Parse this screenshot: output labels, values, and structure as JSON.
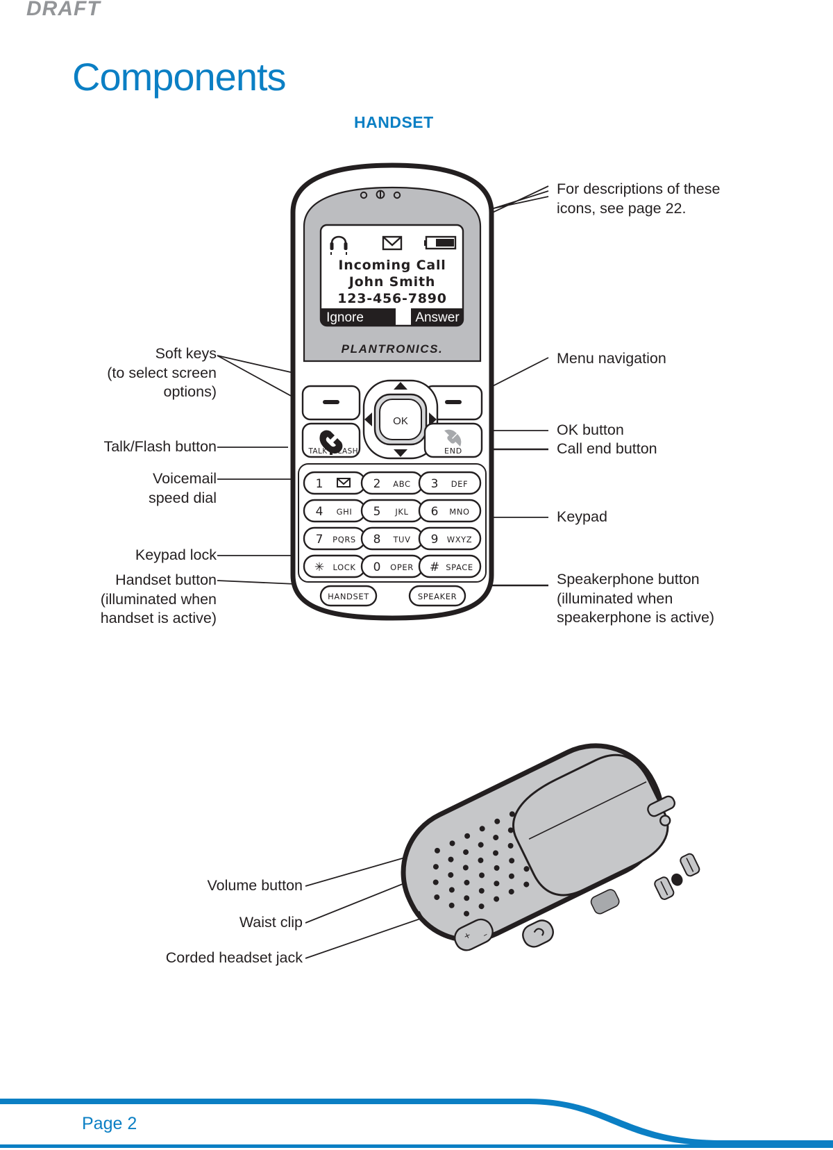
{
  "document": {
    "watermark": "DRAFT",
    "title": "Components",
    "page_number": "Page 2",
    "accent_color": "#0b7fc4",
    "text_color": "#231f20",
    "watermark_color": "#939598"
  },
  "sections": {
    "handset_heading": "HANDSET"
  },
  "screen": {
    "status_icons": [
      "headset-icon",
      "envelope-icon",
      "battery-icon"
    ],
    "line1": "Incoming Call",
    "line2": "John Smith",
    "line3": "123-456-7890",
    "softkey_left": "Ignore",
    "softkey_right": "Answer"
  },
  "brand": {
    "logo_text": "PLANTRONICS",
    "logo_suffix": "."
  },
  "keypad": {
    "nav_ok": "OK",
    "talk_label_left": "TALK",
    "talk_label_right": "FLASH",
    "end_label": "END",
    "handset_label": "HANDSET",
    "speaker_label": "SPEAKER",
    "keys": [
      {
        "digit": "1",
        "letters": "",
        "icon": "envelope-icon"
      },
      {
        "digit": "2",
        "letters": "ABC",
        "icon": ""
      },
      {
        "digit": "3",
        "letters": "DEF",
        "icon": ""
      },
      {
        "digit": "4",
        "letters": "GHI",
        "icon": ""
      },
      {
        "digit": "5",
        "letters": "JKL",
        "icon": ""
      },
      {
        "digit": "6",
        "letters": "MNO",
        "icon": ""
      },
      {
        "digit": "7",
        "letters": "PQRS",
        "icon": ""
      },
      {
        "digit": "8",
        "letters": "TUV",
        "icon": ""
      },
      {
        "digit": "9",
        "letters": "WXYZ",
        "icon": ""
      },
      {
        "digit": "✳",
        "letters": "LOCK",
        "icon": ""
      },
      {
        "digit": "0",
        "letters": "OPER",
        "icon": ""
      },
      {
        "digit": "#",
        "letters": "SPACE",
        "icon": ""
      }
    ]
  },
  "callouts_left": [
    {
      "id": "soft-keys",
      "text": "Soft keys\n(to select screen\noptions)"
    },
    {
      "id": "talk-flash-button",
      "text": "Talk/Flash button"
    },
    {
      "id": "voicemail-speed-dial",
      "text": "Voicemail\nspeed dial"
    },
    {
      "id": "keypad-lock",
      "text": "Keypad lock"
    },
    {
      "id": "handset-button",
      "text": "Handset button\n(illuminated when\nhandset is active)"
    }
  ],
  "callouts_right": [
    {
      "id": "icon-descriptions",
      "text": "For descriptions of these\nicons, see page 22."
    },
    {
      "id": "menu-navigation",
      "text": "Menu navigation"
    },
    {
      "id": "ok-button",
      "text": "OK button"
    },
    {
      "id": "call-end-button",
      "text": "Call end button"
    },
    {
      "id": "keypad",
      "text": "Keypad"
    },
    {
      "id": "speakerphone-button",
      "text": "Speakerphone button\n(illuminated when\nspeakerphone is active)"
    }
  ],
  "callouts_cradle": [
    {
      "id": "volume-button",
      "text": "Volume button"
    },
    {
      "id": "waist-clip",
      "text": "Waist clip"
    },
    {
      "id": "corded-headset-jack",
      "text": "Corded headset jack"
    }
  ]
}
